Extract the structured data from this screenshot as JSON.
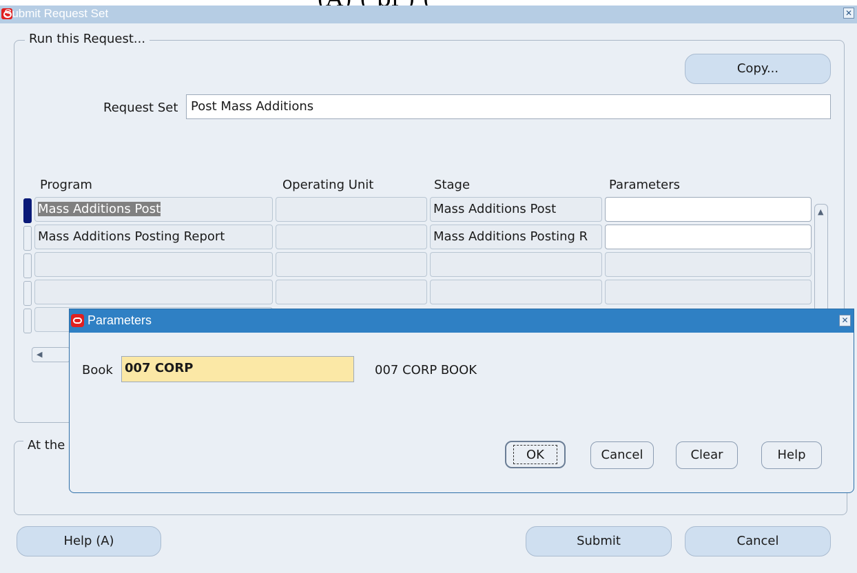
{
  "top_clipped_text": "(A)           (   pi     ) (",
  "window": {
    "title": "Submit Request Set"
  },
  "run_group": {
    "label": "Run this Request..."
  },
  "copy_button": {
    "label": "Copy..."
  },
  "request_set": {
    "label": "Request Set",
    "value": "Post Mass Additions"
  },
  "table": {
    "headers": {
      "program": "Program",
      "operating_unit": "Operating Unit",
      "stage": "Stage",
      "parameters": "Parameters"
    },
    "rows": [
      {
        "program": "Mass Additions Post",
        "operating_unit": "",
        "stage": "Mass Additions Post",
        "parameters": ""
      },
      {
        "program": "Mass Additions Posting Report",
        "operating_unit": "",
        "stage": "Mass Additions Posting R",
        "parameters": ""
      },
      {
        "program": "",
        "operating_unit": "",
        "stage": "",
        "parameters": ""
      },
      {
        "program": "",
        "operating_unit": "",
        "stage": "",
        "parameters": ""
      },
      {
        "program": "",
        "operating_unit": "",
        "stage": "",
        "parameters": ""
      }
    ]
  },
  "at_group": {
    "label": "At the"
  },
  "footer": {
    "help_label": "Help (A)",
    "submit_label": "Submit",
    "cancel_label": "Cancel"
  },
  "dialog": {
    "title": "Parameters",
    "book_label": "Book",
    "book_value": "007 CORP",
    "book_description": "007 CORP BOOK",
    "ok_label": "OK",
    "cancel_label": "Cancel",
    "clear_label": "Clear",
    "help_label": "Help"
  },
  "colors": {
    "title_bar_active": "#2f80c4",
    "title_bar_inactive": "#b6cde4",
    "window_bg": "#eaeff5",
    "required_field": "#fbe8a6",
    "selected_row_marker": "#0a1a78",
    "oracle_logo": "#e02020"
  },
  "icons": {
    "app_logo": "oracle-logo-icon",
    "close": "close-icon",
    "scroll_up": "scroll-up-arrow-icon",
    "scroll_left": "scroll-left-arrow-icon"
  }
}
